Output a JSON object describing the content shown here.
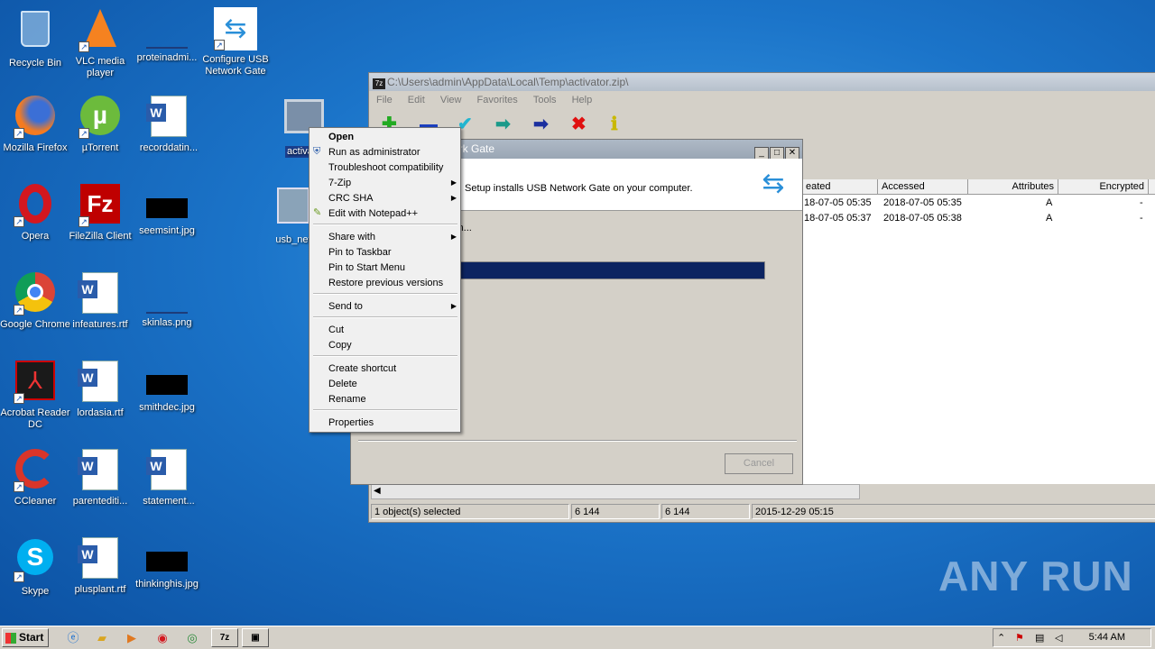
{
  "desktop": {
    "icons": [
      {
        "label": "Recycle Bin"
      },
      {
        "label": "VLC media player"
      },
      {
        "label": "proteinadmi..."
      },
      {
        "label": "Configure USB Network Gate"
      },
      {
        "label": "Mozilla Firefox"
      },
      {
        "label": "µTorrent"
      },
      {
        "label": "recorddatin..."
      },
      {
        "label": "activato"
      },
      {
        "label": "Opera"
      },
      {
        "label": "FileZilla Client"
      },
      {
        "label": "seemsint.jpg"
      },
      {
        "label": "usb_net"
      },
      {
        "label": "Google Chrome"
      },
      {
        "label": "infeatures.rtf"
      },
      {
        "label": "skinlas.png"
      },
      {
        "label": "Acrobat Reader DC"
      },
      {
        "label": "lordasia.rtf"
      },
      {
        "label": "smithdec.jpg"
      },
      {
        "label": "CCleaner"
      },
      {
        "label": "parentediti..."
      },
      {
        "label": "statement..."
      },
      {
        "label": "Skype"
      },
      {
        "label": "plusplant.rtf"
      },
      {
        "label": "thinkinghis.jpg"
      }
    ]
  },
  "zip_window": {
    "title": "C:\\Users\\admin\\AppData\\Local\\Temp\\activator.zip\\",
    "app_icon_text": "7z",
    "menu": [
      "File",
      "Edit",
      "View",
      "Favorites",
      "Tools",
      "Help"
    ],
    "columns": [
      "eated",
      "Accessed",
      "Attributes",
      "Encrypted"
    ],
    "rows": [
      {
        "created": "18-07-05 05:35",
        "accessed": "2018-07-05 05:35",
        "attributes": "A",
        "encrypted": "-"
      },
      {
        "created": "18-07-05 05:37",
        "accessed": "2018-07-05 05:38",
        "attributes": "A",
        "encrypted": "-"
      }
    ],
    "status": {
      "selected": "1 object(s) selected",
      "size": "6 144",
      "packed": "6 144",
      "modified": "2015-12-29 05:15"
    }
  },
  "setup_dialog": {
    "title": "ork Gate",
    "banner_text": "Setup installs USB Network Gate on your computer.",
    "status_text": "ion...",
    "progress": 1.0,
    "cancel_label": "Cancel"
  },
  "context_menu": {
    "items": [
      {
        "label": "Open"
      },
      {
        "label": "Run as administrator"
      },
      {
        "label": "Troubleshoot compatibility"
      },
      {
        "label": "7-Zip"
      },
      {
        "label": "CRC SHA"
      },
      {
        "label": "Edit with Notepad++"
      },
      {
        "label": "Share with"
      },
      {
        "label": "Pin to Taskbar"
      },
      {
        "label": "Pin to Start Menu"
      },
      {
        "label": "Restore previous versions"
      },
      {
        "label": "Send to"
      },
      {
        "label": "Cut"
      },
      {
        "label": "Copy"
      },
      {
        "label": "Create shortcut"
      },
      {
        "label": "Delete"
      },
      {
        "label": "Rename"
      },
      {
        "label": "Properties"
      }
    ]
  },
  "taskbar": {
    "start_label": "Start",
    "task_7z": "7z",
    "clock": "5:44 AM"
  },
  "watermark": "ANY RUN"
}
